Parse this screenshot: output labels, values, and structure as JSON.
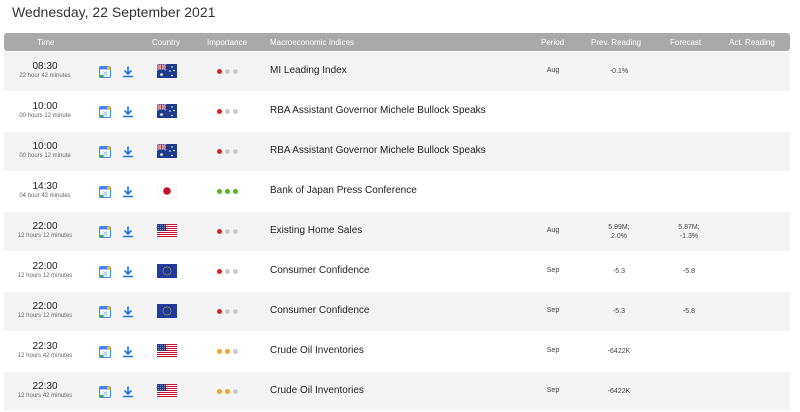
{
  "date_title": "Wednesday, 22 September 2021",
  "headers": {
    "time": "Time",
    "country": "Country",
    "importance": "Importance",
    "indices": "Macroeconomic Indices",
    "period": "Period",
    "prev": "Prev. Reading",
    "forecast": "Forecast",
    "actual": "Act. Reading"
  },
  "colors": {
    "header_bg": "#a9a9a9",
    "low": "#e02020",
    "medium": "#f5a623",
    "high": "#4cbb17",
    "inactive": "#cccccc"
  },
  "rows": [
    {
      "time": "08:30",
      "countdown": "22 hour 42 minutes",
      "country_flag": "australia",
      "importance": "low",
      "indicator": "MI Leading Index",
      "period": "Aug",
      "prev": "-0.1%",
      "forecast": ""
    },
    {
      "time": "10:00",
      "countdown": "00 hours 12 minute",
      "country_flag": "australia",
      "importance": "low",
      "indicator": "RBA Assistant Governor Michele Bullock Speaks",
      "period": "",
      "prev": "",
      "forecast": ""
    },
    {
      "time": "10:00",
      "countdown": "00 hours 12 minute",
      "country_flag": "australia",
      "importance": "low",
      "indicator": "RBA Assistant Governor Michele Bullock Speaks",
      "period": "",
      "prev": "",
      "forecast": ""
    },
    {
      "time": "14:30",
      "countdown": "04 hour 42 minutes",
      "country_flag": "japan",
      "importance": "high",
      "indicator": "Bank of Japan Press Conference",
      "period": "",
      "prev": "",
      "forecast": ""
    },
    {
      "time": "22:00",
      "countdown": "12 hours 12 minutes",
      "country_flag": "usa",
      "importance": "low",
      "indicator": "Existing Home Sales",
      "period": "Aug",
      "prev": "5.99M;",
      "prev2": "2.0%",
      "forecast": "5.87M;",
      "forecast2": "-1.3%"
    },
    {
      "time": "22:00",
      "countdown": "12 hours 12 minutes",
      "country_flag": "eu",
      "importance": "low",
      "indicator": "Consumer Confidence",
      "period": "Sep",
      "prev": "-5.3",
      "forecast": "-5.8"
    },
    {
      "time": "22:00",
      "countdown": "12 hours 12 minutes",
      "country_flag": "eu",
      "importance": "low",
      "indicator": "Consumer Confidence",
      "period": "Sep",
      "prev": "-5.3",
      "forecast": "-5.8"
    },
    {
      "time": "22:30",
      "countdown": "12 hours 42 minutes",
      "country_flag": "usa",
      "importance": "medium",
      "indicator": "Crude Oil Inventories",
      "period": "Sep",
      "prev": "-6422K",
      "forecast": ""
    },
    {
      "time": "22:30",
      "countdown": "12 hours 42 minutes",
      "country_flag": "usa",
      "importance": "medium",
      "indicator": "Crude Oil Inventories",
      "period": "Sep",
      "prev": "-6422K",
      "forecast": ""
    }
  ]
}
